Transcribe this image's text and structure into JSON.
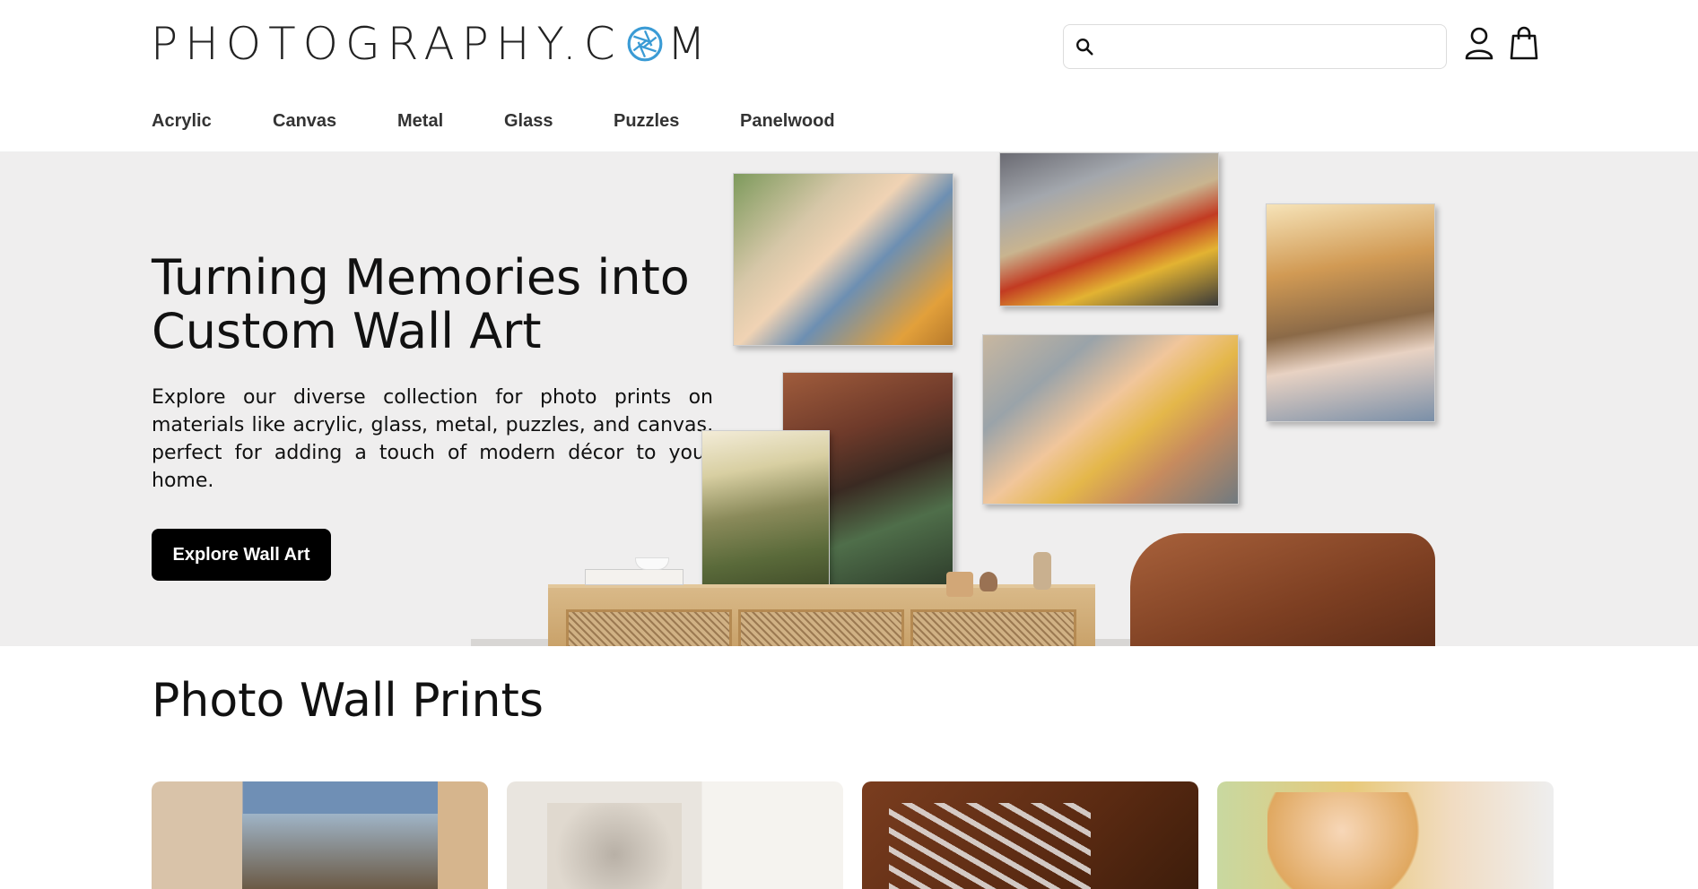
{
  "brand": {
    "logo_before": "PHOTOGRAPHY.C",
    "logo_after": "M",
    "aperture_color": "#3a9bd5"
  },
  "search": {
    "placeholder": ""
  },
  "nav": {
    "items": [
      {
        "label": "Acrylic"
      },
      {
        "label": "Canvas"
      },
      {
        "label": "Metal"
      },
      {
        "label": "Glass"
      },
      {
        "label": "Puzzles"
      },
      {
        "label": "Panelwood"
      }
    ]
  },
  "hero": {
    "title": "Turning Memories into Custom Wall Art",
    "description": "Explore our diverse collection for photo prints on materials like acrylic, glass, metal, puzzles, and canvas, perfect for adding a touch of modern décor to your home.",
    "cta_label": "Explore Wall Art",
    "background_color": "#efeeee"
  },
  "section": {
    "title": "Photo Wall Prints"
  },
  "colors": {
    "text": "#111111",
    "button_bg": "#000000",
    "button_text": "#ffffff"
  },
  "icons": {
    "search": "search-icon",
    "account": "user-icon",
    "cart": "shopping-bag-icon"
  }
}
